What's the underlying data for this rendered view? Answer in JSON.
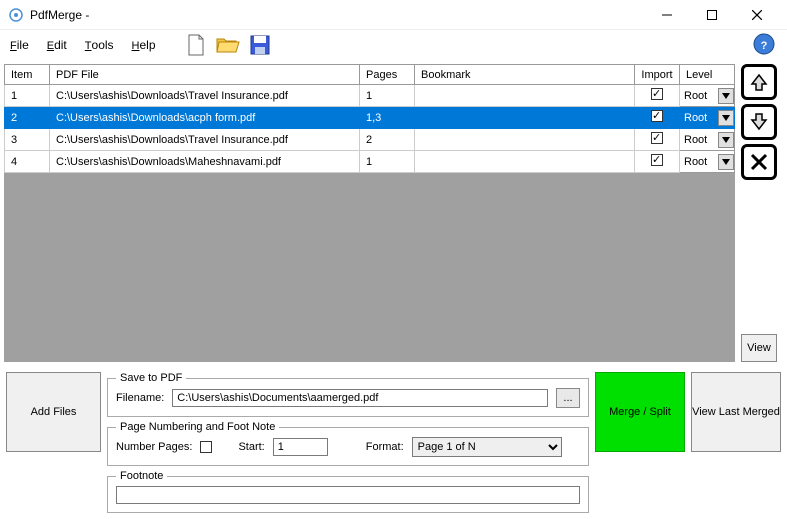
{
  "window": {
    "title": "PdfMerge -"
  },
  "menu": {
    "file": "File",
    "edit": "Edit",
    "tools": "Tools",
    "help": "Help"
  },
  "table": {
    "headers": {
      "item": "Item",
      "pdf_file": "PDF File",
      "pages": "Pages",
      "bookmark": "Bookmark",
      "import": "Import",
      "level": "Level"
    },
    "rows": [
      {
        "item": "1",
        "file": "C:\\Users\\ashis\\Downloads\\Travel Insurance.pdf",
        "pages": "1",
        "bookmark": "",
        "import": true,
        "level": "Root",
        "selected": false
      },
      {
        "item": "2",
        "file": "C:\\Users\\ashis\\Downloads\\acph form.pdf",
        "pages": "1,3",
        "bookmark": "",
        "import": true,
        "level": "Root",
        "selected": true
      },
      {
        "item": "3",
        "file": "C:\\Users\\ashis\\Downloads\\Travel Insurance.pdf",
        "pages": "2",
        "bookmark": "",
        "import": true,
        "level": "Root",
        "selected": false
      },
      {
        "item": "4",
        "file": "C:\\Users\\ashis\\Downloads\\Maheshnavami.pdf",
        "pages": "1",
        "bookmark": "",
        "import": true,
        "level": "Root",
        "selected": false
      }
    ]
  },
  "buttons": {
    "view": "View",
    "add_files": "Add Files",
    "merge_split": "Merge / Split",
    "view_last": "View Last Merged",
    "browse": "..."
  },
  "save_to_pdf": {
    "legend": "Save to PDF",
    "filename_label": "Filename:",
    "filename_value": "C:\\Users\\ashis\\Documents\\aamerged.pdf"
  },
  "page_numbering": {
    "legend": "Page Numbering and Foot Note",
    "number_pages_label": "Number Pages:",
    "start_label": "Start:",
    "start_value": "1",
    "format_label": "Format:",
    "format_value": "Page 1 of N"
  },
  "footnote": {
    "legend": "Footnote",
    "value": ""
  }
}
